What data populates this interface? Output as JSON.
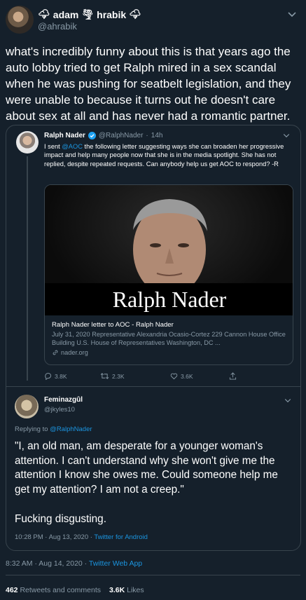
{
  "author": {
    "name_left_emoji": "🌩",
    "name_first": "adam",
    "name_mid_emoji": "🌪",
    "name_last": "hrabik",
    "name_right_emoji": "🌩",
    "handle": "@ahrabik"
  },
  "tweet_text": "what's incredibly funny about this is that years ago the auto lobby tried to get Ralph mired in a sex scandal when he was pushing for seatbelt legislation, and they were unable to because it turns out he doesn't care about sex at all and has never had a romantic partner.",
  "quoted_tweet": {
    "name": "Ralph Nader",
    "handle": "@RalphNader",
    "time": "14h",
    "text_prefix": "I sent ",
    "text_mention": "@AOC",
    "text_suffix": " the following letter suggesting ways she can broaden her progressive impact and help many people now that she is in the media spotlight. She has not replied, despite repeated requests. Can anybody help us get AOC to respond? -R",
    "card": {
      "image_caption": "Ralph Nader",
      "title": "Ralph Nader letter to AOC - Ralph Nader",
      "description": "July 31, 2020 Representative Alexandria Ocasio-Cortez 229 Cannon House Office Building U.S. House of Representatives Washington, DC ...",
      "domain": "nader.org"
    },
    "actions": {
      "replies": "3.8K",
      "retweets": "2.3K",
      "likes": "3.6K"
    }
  },
  "reply_tweet": {
    "name": "Feminazgûl",
    "handle": "@jkyles10",
    "replying_label": "Replying to ",
    "replying_to": "@RalphNader",
    "text": "\"I, an old man, am desperate for a younger woman's attention. I can't understand why she won't give me the attention I know she owes me. Could someone help me get my attention? I am not a creep.\"",
    "text2": "Fucking disgusting.",
    "time": "10:28 PM · Aug 13, 2020 · ",
    "source": "Twitter for Android"
  },
  "main_time": "8:32 AM · Aug 14, 2020 · ",
  "main_source": "Twitter Web App",
  "stats": {
    "retweets_count": "462",
    "retweets_label": " Retweets and comments",
    "likes_count": "3.6K",
    "likes_label": " Likes"
  },
  "colors": {
    "background": "#15202b",
    "border": "#38444d",
    "muted": "#8899a6",
    "link": "#1b95e0",
    "verified": "#1da1f2"
  },
  "icons": [
    "chevron-down-icon",
    "verified-badge-icon",
    "reply-icon",
    "retweet-icon",
    "like-icon",
    "share-icon",
    "link-icon"
  ]
}
